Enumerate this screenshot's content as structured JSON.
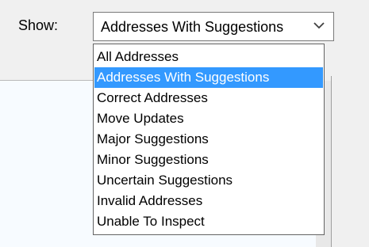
{
  "filter": {
    "label": "Show:",
    "selected_value": "Addresses With Suggestions",
    "options": [
      "All Addresses",
      "Addresses With Suggestions",
      "Correct Addresses",
      "Move Updates",
      "Major Suggestions",
      "Minor Suggestions",
      "Uncertain Suggestions",
      "Invalid Addresses",
      "Unable To Inspect"
    ],
    "highlighted_index": 1,
    "dropdown_icon": "chevron-down-icon"
  },
  "colors": {
    "highlight": "#3399ff",
    "highlight_text": "#ffffff",
    "background": "#f0f0f0",
    "panel": "#f7fbff"
  }
}
